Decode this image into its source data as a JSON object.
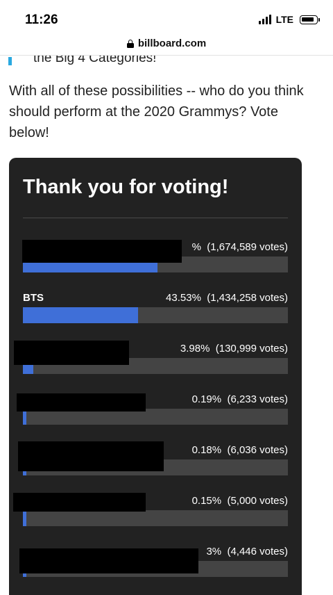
{
  "status_bar": {
    "time": "11:26",
    "network": "LTE",
    "icons": [
      "signal-icon",
      "battery-icon"
    ]
  },
  "browser": {
    "url": "billboard.com",
    "icons": [
      "lock-icon"
    ]
  },
  "article": {
    "cut_off_line": "the Big 4 Categories!",
    "intro": "With all of these possibilities -- who do you think should perform at the 2020 Grammys? Vote below!"
  },
  "poll": {
    "title": "Thank you for voting!",
    "bar_color": "#3f6fd8",
    "options": [
      {
        "name": "",
        "stats": "%  (1,674,589 votes)",
        "fill_fraction": 0.5083
      },
      {
        "name": "BTS",
        "stats": "43.53%  (1,434,258 votes)",
        "fill_fraction": 0.4353
      },
      {
        "name": "",
        "stats": "3.98%  (130,999 votes)",
        "fill_fraction": 0.0398
      },
      {
        "name": "",
        "stats": "0.19%  (6,233 votes)",
        "fill_fraction": 0.0019
      },
      {
        "name": "",
        "stats": "0.18%  (6,036 votes)",
        "fill_fraction": 0.0018
      },
      {
        "name": "",
        "stats": "0.15%  (5,000 votes)",
        "fill_fraction": 0.0015
      },
      {
        "name": "",
        "stats": "3%  (4,446 votes)",
        "fill_fraction": 0.0013
      }
    ]
  }
}
